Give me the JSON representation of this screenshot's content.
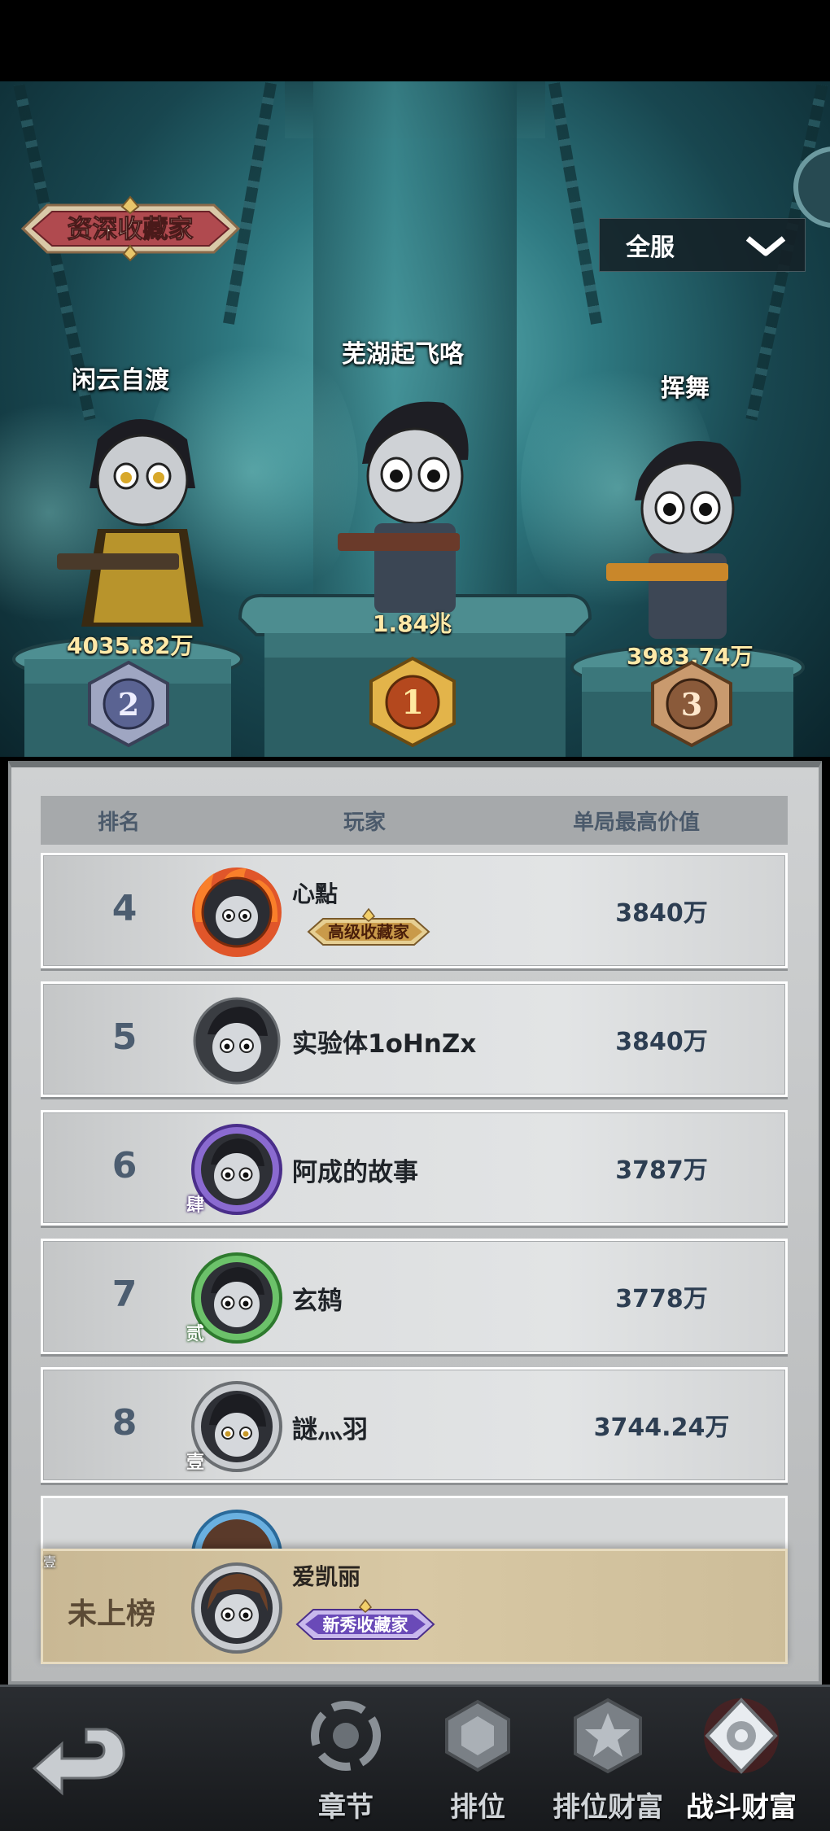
{
  "podium": {
    "title_badge": "资深收藏家",
    "server_select": "全服",
    "first": {
      "rank": "1",
      "name": "芜湖起飞咯",
      "value": "1.84兆"
    },
    "second": {
      "rank": "2",
      "name": "闲云自渡",
      "value": "4035.82万"
    },
    "third": {
      "rank": "3",
      "name": "挥舞",
      "value": "3983.74万"
    }
  },
  "table": {
    "headers": {
      "rank": "排名",
      "player": "玩家",
      "value": "单局最高价值"
    },
    "rows": [
      {
        "rank": "4",
        "name": "心點",
        "value": "3840万",
        "title": "高级收藏家",
        "tier": ""
      },
      {
        "rank": "5",
        "name": "实验体1oHnZx",
        "value": "3840万",
        "title": "",
        "tier": ""
      },
      {
        "rank": "6",
        "name": "阿成的故事",
        "value": "3787万",
        "title": "",
        "tier": "肆"
      },
      {
        "rank": "7",
        "name": "玄鸫",
        "value": "3778万",
        "title": "",
        "tier": "贰"
      },
      {
        "rank": "8",
        "name": "謎灬羽",
        "value": "3744.24万",
        "title": "",
        "tier": "壹"
      }
    ]
  },
  "self": {
    "status": "未上榜",
    "name": "爱凯丽",
    "title": "新秀收藏家",
    "tier": "壹"
  },
  "nav": {
    "items": [
      {
        "label": "章节",
        "icon": "chapter-icon"
      },
      {
        "label": "排位",
        "icon": "rank-icon"
      },
      {
        "label": "排位财富",
        "icon": "rank-wealth-icon"
      },
      {
        "label": "战斗财富",
        "icon": "battle-wealth-icon"
      }
    ],
    "active": "战斗财富"
  },
  "colors": {
    "scene_teal": "#2f7a82",
    "gold_text": "#ffe9a8",
    "rank_num": "#4c5d70",
    "self_row": "#d8c8a4"
  }
}
